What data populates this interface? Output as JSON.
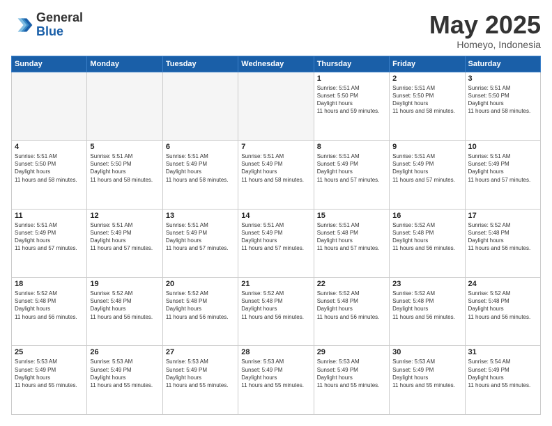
{
  "header": {
    "logo_general": "General",
    "logo_blue": "Blue",
    "month_title": "May 2025",
    "location": "Homeyo, Indonesia"
  },
  "weekdays": [
    "Sunday",
    "Monday",
    "Tuesday",
    "Wednesday",
    "Thursday",
    "Friday",
    "Saturday"
  ],
  "weeks": [
    [
      {
        "day": "",
        "empty": true
      },
      {
        "day": "",
        "empty": true
      },
      {
        "day": "",
        "empty": true
      },
      {
        "day": "",
        "empty": true
      },
      {
        "day": "1",
        "sunrise": "5:51 AM",
        "sunset": "5:50 PM",
        "daylight": "11 hours and 59 minutes."
      },
      {
        "day": "2",
        "sunrise": "5:51 AM",
        "sunset": "5:50 PM",
        "daylight": "11 hours and 58 minutes."
      },
      {
        "day": "3",
        "sunrise": "5:51 AM",
        "sunset": "5:50 PM",
        "daylight": "11 hours and 58 minutes."
      }
    ],
    [
      {
        "day": "4",
        "sunrise": "5:51 AM",
        "sunset": "5:50 PM",
        "daylight": "11 hours and 58 minutes."
      },
      {
        "day": "5",
        "sunrise": "5:51 AM",
        "sunset": "5:50 PM",
        "daylight": "11 hours and 58 minutes."
      },
      {
        "day": "6",
        "sunrise": "5:51 AM",
        "sunset": "5:49 PM",
        "daylight": "11 hours and 58 minutes."
      },
      {
        "day": "7",
        "sunrise": "5:51 AM",
        "sunset": "5:49 PM",
        "daylight": "11 hours and 58 minutes."
      },
      {
        "day": "8",
        "sunrise": "5:51 AM",
        "sunset": "5:49 PM",
        "daylight": "11 hours and 57 minutes."
      },
      {
        "day": "9",
        "sunrise": "5:51 AM",
        "sunset": "5:49 PM",
        "daylight": "11 hours and 57 minutes."
      },
      {
        "day": "10",
        "sunrise": "5:51 AM",
        "sunset": "5:49 PM",
        "daylight": "11 hours and 57 minutes."
      }
    ],
    [
      {
        "day": "11",
        "sunrise": "5:51 AM",
        "sunset": "5:49 PM",
        "daylight": "11 hours and 57 minutes."
      },
      {
        "day": "12",
        "sunrise": "5:51 AM",
        "sunset": "5:49 PM",
        "daylight": "11 hours and 57 minutes."
      },
      {
        "day": "13",
        "sunrise": "5:51 AM",
        "sunset": "5:49 PM",
        "daylight": "11 hours and 57 minutes."
      },
      {
        "day": "14",
        "sunrise": "5:51 AM",
        "sunset": "5:49 PM",
        "daylight": "11 hours and 57 minutes."
      },
      {
        "day": "15",
        "sunrise": "5:51 AM",
        "sunset": "5:48 PM",
        "daylight": "11 hours and 57 minutes."
      },
      {
        "day": "16",
        "sunrise": "5:52 AM",
        "sunset": "5:48 PM",
        "daylight": "11 hours and 56 minutes."
      },
      {
        "day": "17",
        "sunrise": "5:52 AM",
        "sunset": "5:48 PM",
        "daylight": "11 hours and 56 minutes."
      }
    ],
    [
      {
        "day": "18",
        "sunrise": "5:52 AM",
        "sunset": "5:48 PM",
        "daylight": "11 hours and 56 minutes."
      },
      {
        "day": "19",
        "sunrise": "5:52 AM",
        "sunset": "5:48 PM",
        "daylight": "11 hours and 56 minutes."
      },
      {
        "day": "20",
        "sunrise": "5:52 AM",
        "sunset": "5:48 PM",
        "daylight": "11 hours and 56 minutes."
      },
      {
        "day": "21",
        "sunrise": "5:52 AM",
        "sunset": "5:48 PM",
        "daylight": "11 hours and 56 minutes."
      },
      {
        "day": "22",
        "sunrise": "5:52 AM",
        "sunset": "5:48 PM",
        "daylight": "11 hours and 56 minutes."
      },
      {
        "day": "23",
        "sunrise": "5:52 AM",
        "sunset": "5:48 PM",
        "daylight": "11 hours and 56 minutes."
      },
      {
        "day": "24",
        "sunrise": "5:52 AM",
        "sunset": "5:48 PM",
        "daylight": "11 hours and 56 minutes."
      }
    ],
    [
      {
        "day": "25",
        "sunrise": "5:53 AM",
        "sunset": "5:49 PM",
        "daylight": "11 hours and 55 minutes."
      },
      {
        "day": "26",
        "sunrise": "5:53 AM",
        "sunset": "5:49 PM",
        "daylight": "11 hours and 55 minutes."
      },
      {
        "day": "27",
        "sunrise": "5:53 AM",
        "sunset": "5:49 PM",
        "daylight": "11 hours and 55 minutes."
      },
      {
        "day": "28",
        "sunrise": "5:53 AM",
        "sunset": "5:49 PM",
        "daylight": "11 hours and 55 minutes."
      },
      {
        "day": "29",
        "sunrise": "5:53 AM",
        "sunset": "5:49 PM",
        "daylight": "11 hours and 55 minutes."
      },
      {
        "day": "30",
        "sunrise": "5:53 AM",
        "sunset": "5:49 PM",
        "daylight": "11 hours and 55 minutes."
      },
      {
        "day": "31",
        "sunrise": "5:54 AM",
        "sunset": "5:49 PM",
        "daylight": "11 hours and 55 minutes."
      }
    ]
  ]
}
